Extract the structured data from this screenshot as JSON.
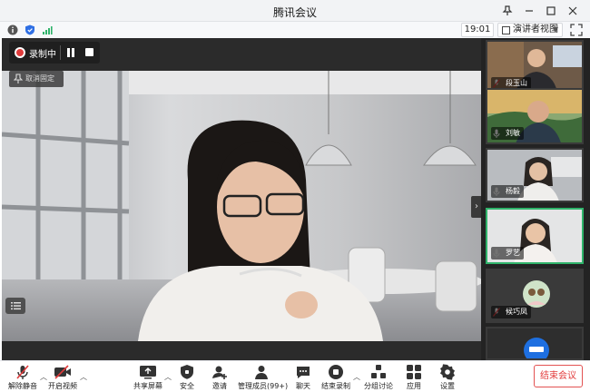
{
  "window": {
    "title": "腾讯会议"
  },
  "infobar": {
    "time": "19:01",
    "view_label": "演讲者视图"
  },
  "recording": {
    "label": "录制中"
  },
  "stage": {
    "unpin_label": "取消固定"
  },
  "participants": [
    {
      "name": "段玉山",
      "mic": "muted"
    },
    {
      "name": "刘敏",
      "mic": "on"
    },
    {
      "name": "杨毅",
      "mic": "on"
    },
    {
      "name": "罗艺",
      "mic": "on",
      "active": true
    },
    {
      "name": "候巧凤",
      "mic": "muted"
    },
    {
      "name": "",
      "mic": ""
    }
  ],
  "toolbar": {
    "unmute": "解除静音",
    "start_video": "开启视频",
    "share_screen": "共享屏幕",
    "security": "安全",
    "invite": "邀请",
    "manage_members": "管理成员(99+)",
    "chat": "聊天",
    "end_recording": "结束录制",
    "breakout": "分组讨论",
    "apps": "应用",
    "settings": "设置",
    "end_meeting": "结束会议"
  },
  "colors": {
    "accent": "#2f6fe4",
    "recording": "#e03b3b",
    "end": "#e23c3c",
    "active_border": "#2fb36a"
  }
}
